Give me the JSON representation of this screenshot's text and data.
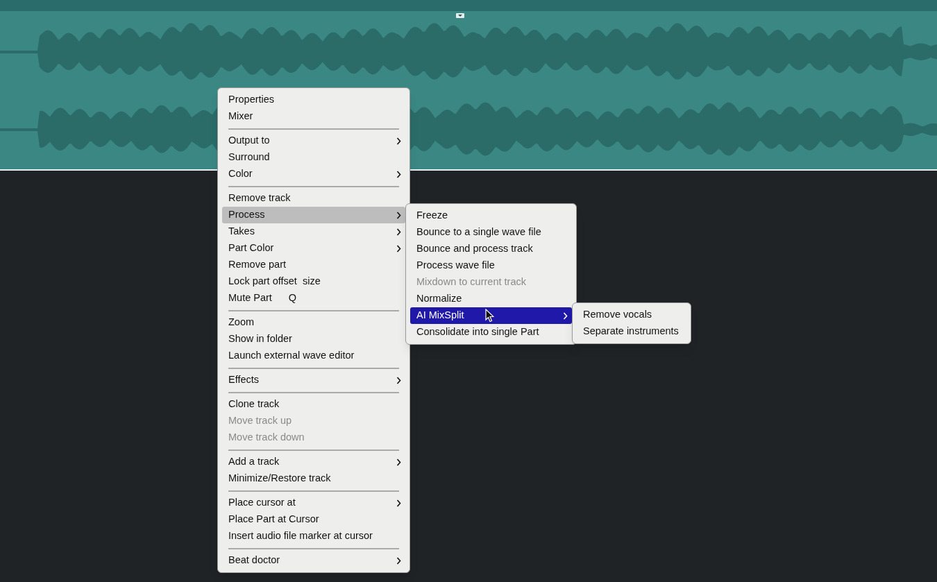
{
  "menus": [
    {
      "focused": false,
      "items": [
        {
          "kind": "item",
          "label": "Properties",
          "submenu": false,
          "disabled": false,
          "selected": false
        },
        {
          "kind": "item",
          "label": "Mixer",
          "submenu": false,
          "disabled": false,
          "selected": false
        },
        {
          "kind": "separator"
        },
        {
          "kind": "item",
          "label": "Output to",
          "submenu": true,
          "disabled": false,
          "selected": false
        },
        {
          "kind": "item",
          "label": "Surround",
          "submenu": false,
          "disabled": false,
          "selected": false
        },
        {
          "kind": "item",
          "label": "Color",
          "submenu": true,
          "disabled": false,
          "selected": false
        },
        {
          "kind": "separator"
        },
        {
          "kind": "item",
          "label": "Remove track",
          "submenu": false,
          "disabled": false,
          "selected": false
        },
        {
          "kind": "item",
          "label": "Process",
          "submenu": true,
          "disabled": false,
          "selected": true
        },
        {
          "kind": "item",
          "label": "Takes",
          "submenu": true,
          "disabled": false,
          "selected": false
        },
        {
          "kind": "item",
          "label": "Part Color",
          "submenu": true,
          "disabled": false,
          "selected": false
        },
        {
          "kind": "item",
          "label": "Remove part",
          "submenu": false,
          "disabled": false,
          "selected": false
        },
        {
          "kind": "item",
          "label": "Lock part offset  size",
          "submenu": false,
          "disabled": false,
          "selected": false
        },
        {
          "kind": "item",
          "label": "Mute Part",
          "shortcut": "Q",
          "submenu": false,
          "disabled": false,
          "selected": false
        },
        {
          "kind": "separator"
        },
        {
          "kind": "item",
          "label": "Zoom",
          "submenu": false,
          "disabled": false,
          "selected": false
        },
        {
          "kind": "item",
          "label": "Show in folder",
          "submenu": false,
          "disabled": false,
          "selected": false
        },
        {
          "kind": "item",
          "label": "Launch external wave editor",
          "submenu": false,
          "disabled": false,
          "selected": false
        },
        {
          "kind": "separator"
        },
        {
          "kind": "item",
          "label": "Effects",
          "submenu": true,
          "disabled": false,
          "selected": false
        },
        {
          "kind": "separator"
        },
        {
          "kind": "item",
          "label": "Clone track",
          "submenu": false,
          "disabled": false,
          "selected": false
        },
        {
          "kind": "item",
          "label": "Move track up",
          "submenu": false,
          "disabled": true,
          "selected": false
        },
        {
          "kind": "item",
          "label": "Move track down",
          "submenu": false,
          "disabled": true,
          "selected": false
        },
        {
          "kind": "separator"
        },
        {
          "kind": "item",
          "label": "Add a track",
          "submenu": true,
          "disabled": false,
          "selected": false
        },
        {
          "kind": "item",
          "label": "Minimize/Restore track",
          "submenu": false,
          "disabled": false,
          "selected": false
        },
        {
          "kind": "separator"
        },
        {
          "kind": "item",
          "label": "Place cursor at",
          "submenu": true,
          "disabled": false,
          "selected": false
        },
        {
          "kind": "item",
          "label": "Place Part at Cursor",
          "submenu": false,
          "disabled": false,
          "selected": false
        },
        {
          "kind": "item",
          "label": "Insert audio file marker at cursor",
          "submenu": false,
          "disabled": false,
          "selected": false
        },
        {
          "kind": "separator"
        },
        {
          "kind": "item",
          "label": "Beat doctor",
          "submenu": true,
          "disabled": false,
          "selected": false
        }
      ]
    },
    {
      "focused": true,
      "items": [
        {
          "kind": "item",
          "label": "Freeze",
          "submenu": false,
          "disabled": false,
          "selected": false
        },
        {
          "kind": "item",
          "label": "Bounce to a single wave file",
          "submenu": false,
          "disabled": false,
          "selected": false
        },
        {
          "kind": "item",
          "label": "Bounce and process track",
          "submenu": false,
          "disabled": false,
          "selected": false
        },
        {
          "kind": "item",
          "label": "Process wave file",
          "submenu": false,
          "disabled": false,
          "selected": false
        },
        {
          "kind": "item",
          "label": "Mixdown to current track",
          "submenu": false,
          "disabled": true,
          "selected": false
        },
        {
          "kind": "item",
          "label": "Normalize",
          "submenu": false,
          "disabled": false,
          "selected": false
        },
        {
          "kind": "item",
          "label": "AI MixSplit",
          "submenu": true,
          "disabled": false,
          "selected": true
        },
        {
          "kind": "item",
          "label": "Consolidate into single Part",
          "submenu": false,
          "disabled": false,
          "selected": false
        }
      ]
    },
    {
      "items": [
        {
          "kind": "item",
          "label": "Remove vocals",
          "submenu": false,
          "disabled": false,
          "selected": false
        },
        {
          "kind": "item",
          "label": "Separate instruments",
          "submenu": false,
          "disabled": false,
          "selected": false
        }
      ]
    }
  ]
}
